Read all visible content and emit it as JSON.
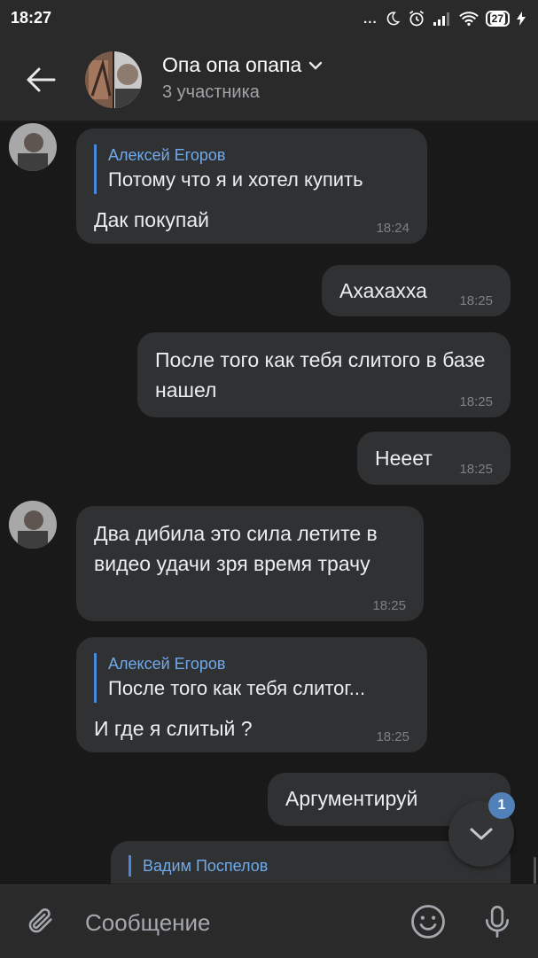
{
  "status_bar": {
    "time": "18:27",
    "dots": "...",
    "battery": "27"
  },
  "header": {
    "title": "Опа опа опапа",
    "subtitle": "3 участника"
  },
  "messages": [
    {
      "type": "incoming",
      "quote_author": "Алексей Егоров",
      "quote_text": "Потому что я и хотел купить",
      "text": "Дак покупай",
      "time": "18:24"
    },
    {
      "type": "outgoing",
      "text": "Ахахахха",
      "time": "18:25"
    },
    {
      "type": "outgoing",
      "text": "После того как тебя слитого в базе нашел",
      "time": "18:25"
    },
    {
      "type": "outgoing",
      "text": "Нееет",
      "time": "18:25"
    },
    {
      "type": "incoming",
      "text": "Два дибила это сила летите в видео удачи зря время трачу",
      "time": "18:25"
    },
    {
      "type": "incoming",
      "quote_author": "Алексей Егоров",
      "quote_text": "После того как тебя слитог...",
      "text": "И где я слитый ?",
      "time": "18:25"
    },
    {
      "type": "outgoing",
      "text": "Аргументируй"
    },
    {
      "type": "outgoing",
      "quote_author": "Вадим Поспелов"
    }
  ],
  "scroll_down": {
    "unread_count": "1"
  },
  "composer": {
    "placeholder": "Сообщение"
  },
  "colors": {
    "background": "#191919",
    "bubble": "#303132",
    "accent": "#71aaeb",
    "badge": "#5181b8"
  },
  "icons": [
    "back-arrow-icon",
    "chevron-down-icon",
    "paperclip-icon",
    "emoji-icon",
    "microphone-icon",
    "scroll-down-chevron-icon"
  ]
}
